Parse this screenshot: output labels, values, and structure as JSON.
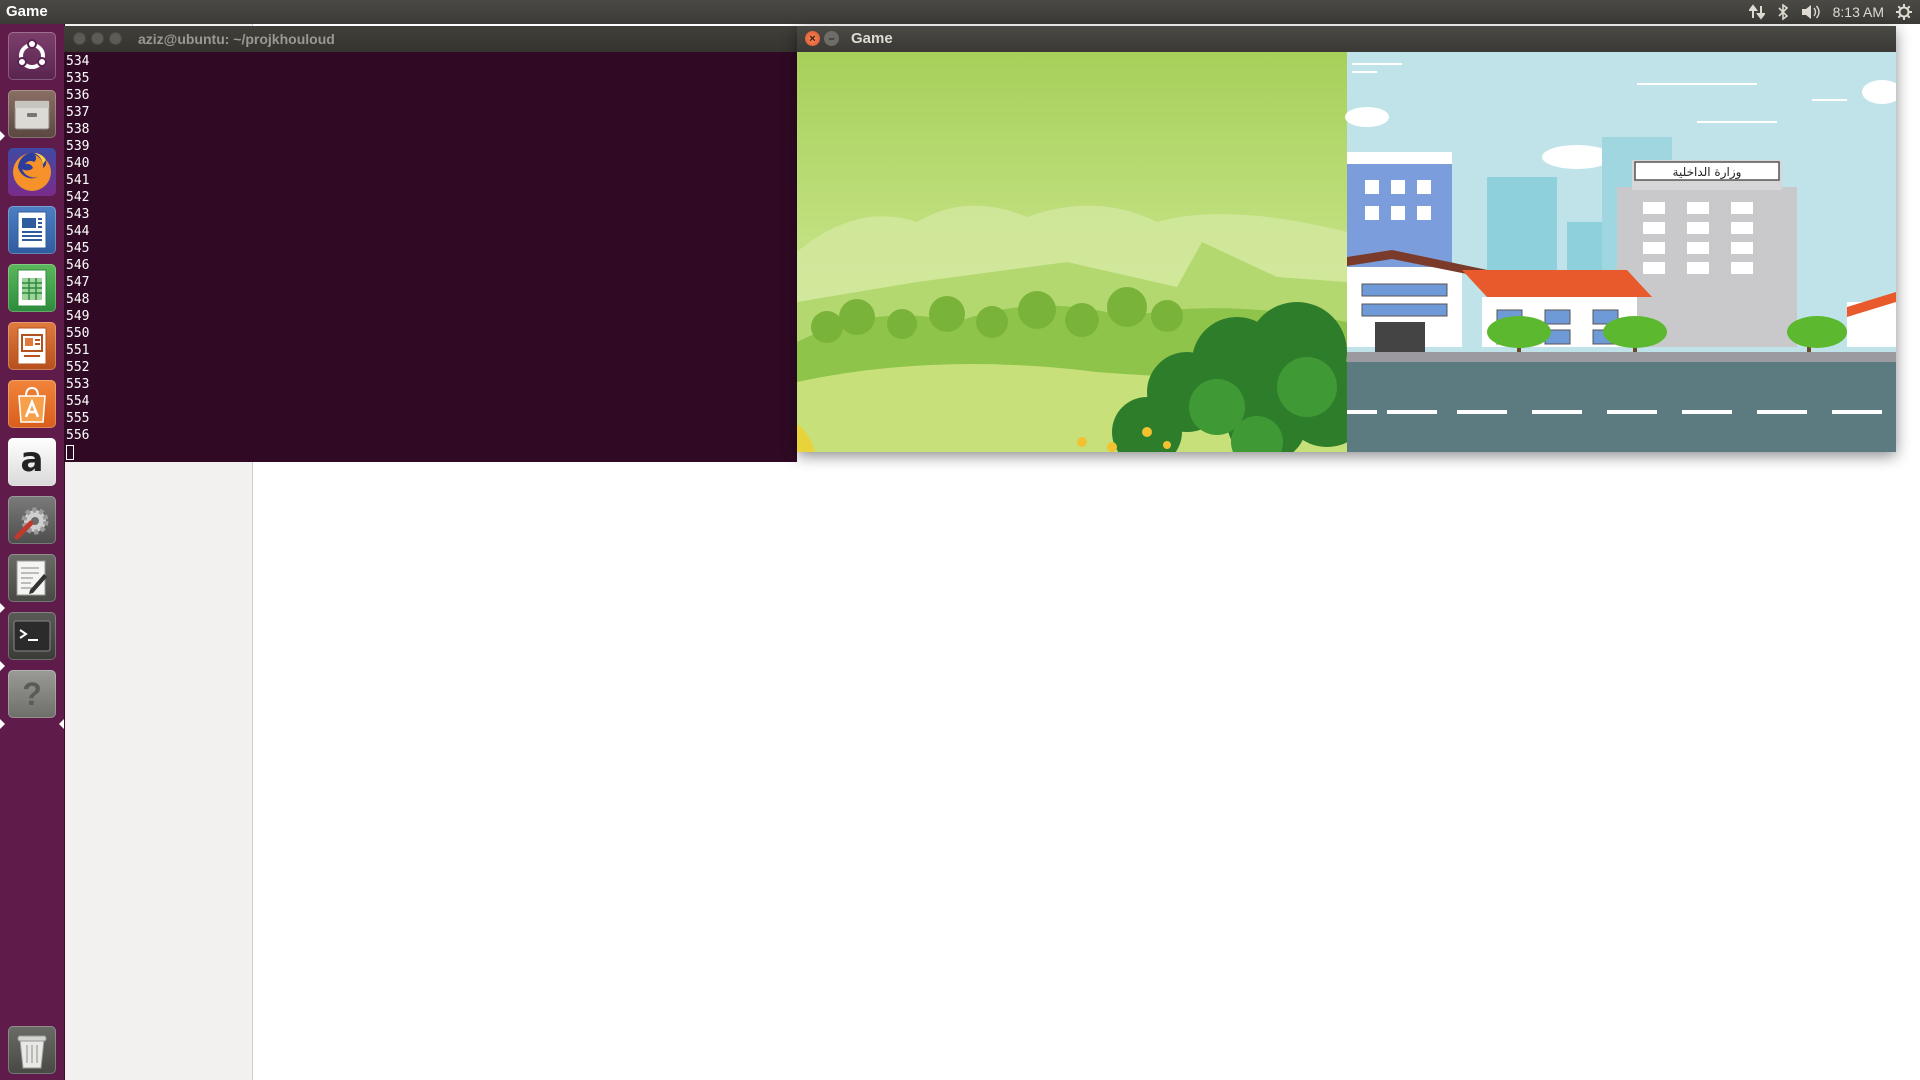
{
  "top_panel": {
    "app_name": "Game",
    "clock": "8:13 AM",
    "tray_icons": [
      "network-icon",
      "bluetooth-icon",
      "volume-icon",
      "system-gear-icon"
    ]
  },
  "launcher": {
    "items": [
      {
        "name": "ubuntu-dash-icon"
      },
      {
        "name": "files-icon"
      },
      {
        "name": "firefox-icon"
      },
      {
        "name": "libreoffice-writer-icon"
      },
      {
        "name": "libreoffice-calc-icon"
      },
      {
        "name": "libreoffice-impress-icon"
      },
      {
        "name": "ubuntu-software-icon"
      },
      {
        "name": "amazon-icon"
      },
      {
        "name": "system-settings-icon"
      },
      {
        "name": "text-editor-icon"
      },
      {
        "name": "terminal-icon"
      },
      {
        "name": "help-icon"
      },
      {
        "name": "trash-icon"
      }
    ],
    "amazon_letter": "a",
    "help_glyph": "?"
  },
  "terminal": {
    "title": "aziz@ubuntu: ~/projkhouloud",
    "lines": [
      "534",
      "535",
      "536",
      "537",
      "538",
      "539",
      "540",
      "541",
      "542",
      "543",
      "544",
      "545",
      "546",
      "547",
      "548",
      "549",
      "550",
      "551",
      "552",
      "553",
      "554",
      "555",
      "556"
    ]
  },
  "game_window": {
    "title": "Game",
    "close_glyph": "×",
    "minimize_glyph": "–",
    "building_sign": "وزارة الداخلية"
  },
  "colors": {
    "launcher_bg": "#5f1b4a",
    "terminal_bg": "#300a24",
    "panel_bg": "#3c3b37",
    "close_button": "#e0522b"
  }
}
